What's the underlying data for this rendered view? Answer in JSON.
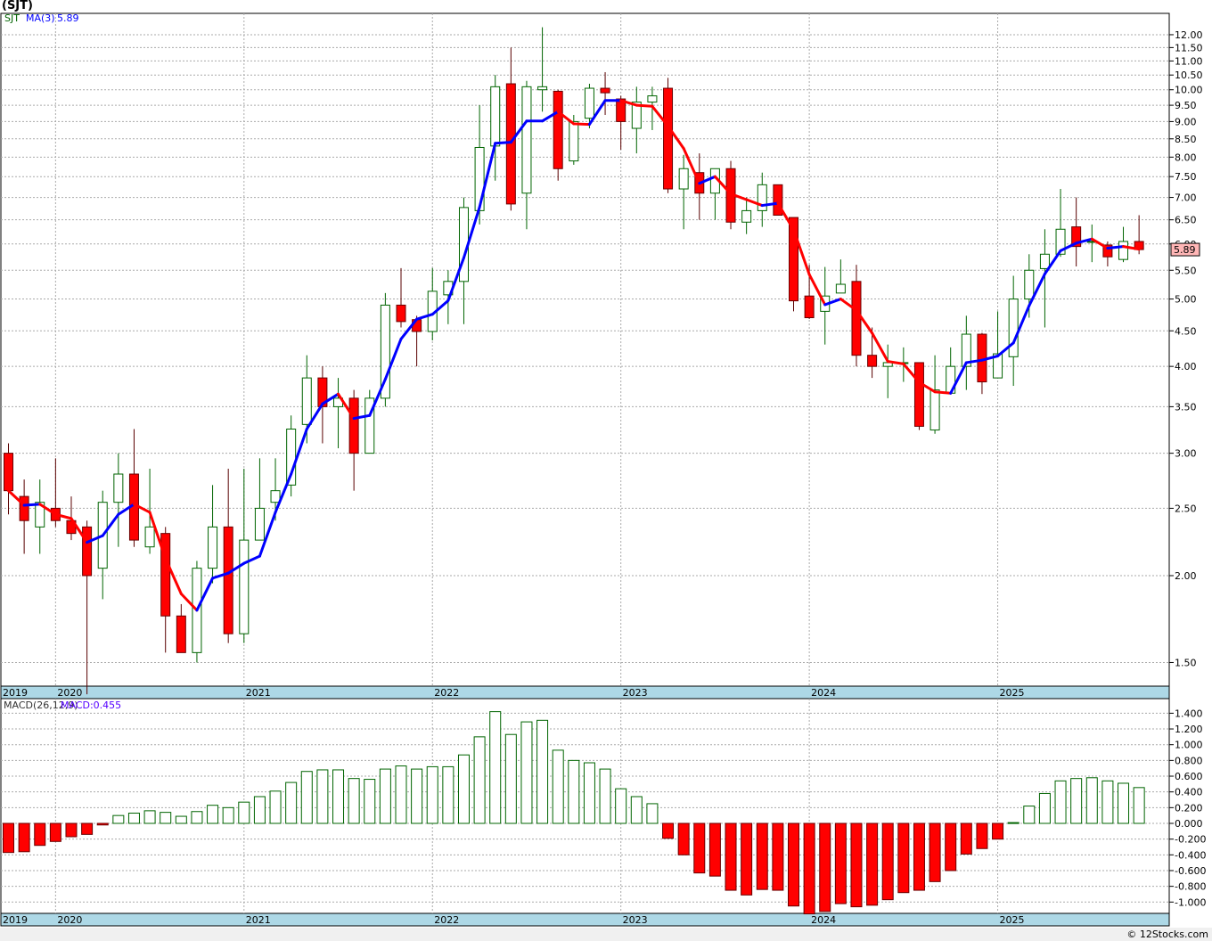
{
  "title": "(SJT)",
  "footer": "© 12Stocks.com",
  "colors": {
    "up": "#006400",
    "down": "#ff0000",
    "ma_up": "#0000ff",
    "ma_down": "#ff0000",
    "date_band": "#add8e6",
    "last_price_box": "#ffb6b6"
  },
  "chart_data": [
    {
      "type": "candlestick",
      "title": "",
      "legend": {
        "symbol": "SJT",
        "indicator": "MA(3)",
        "value": "5.89"
      },
      "y_scale": "log",
      "ylim": [
        1.35,
        12.6
      ],
      "y_ticks": [
        "12.00",
        "11.50",
        "11.00",
        "10.50",
        "10.00",
        "9.50",
        "9.00",
        "8.50",
        "8.00",
        "7.50",
        "7.00",
        "6.50",
        "6.00",
        "5.50",
        "5.00",
        "4.50",
        "4.00",
        "3.50",
        "3.00",
        "2.50",
        "2.00",
        "1.50"
      ],
      "last_price": "5.89",
      "x_labels": [
        "2019",
        "2020",
        "2021",
        "2022",
        "2023",
        "2024",
        "2025"
      ],
      "grid": true,
      "columns": [
        "month",
        "open",
        "high",
        "low",
        "close"
      ],
      "candles": [
        [
          "2019-10",
          3.0,
          3.1,
          2.45,
          2.65
        ],
        [
          "2019-11",
          2.6,
          2.75,
          2.15,
          2.4
        ],
        [
          "2019-12",
          2.35,
          2.75,
          2.15,
          2.55
        ],
        [
          "2020-01",
          2.5,
          2.95,
          2.35,
          2.4
        ],
        [
          "2020-02",
          2.4,
          2.6,
          2.25,
          2.3
        ],
        [
          "2020-03",
          2.35,
          2.4,
          1.35,
          2.0
        ],
        [
          "2020-04",
          2.05,
          2.65,
          1.85,
          2.55
        ],
        [
          "2020-05",
          2.55,
          3.0,
          2.2,
          2.8
        ],
        [
          "2020-06",
          2.8,
          3.25,
          2.2,
          2.25
        ],
        [
          "2020-07",
          2.2,
          2.85,
          2.15,
          2.35
        ],
        [
          "2020-08",
          2.3,
          2.35,
          1.55,
          1.75
        ],
        [
          "2020-09",
          1.75,
          1.82,
          1.55,
          1.55
        ],
        [
          "2020-10",
          1.55,
          2.1,
          1.5,
          2.05
        ],
        [
          "2020-11",
          2.05,
          2.7,
          1.95,
          2.35
        ],
        [
          "2020-12",
          2.35,
          2.85,
          1.6,
          1.65
        ],
        [
          "2021-01",
          1.65,
          2.85,
          1.6,
          2.25
        ],
        [
          "2021-02",
          2.25,
          2.95,
          2.3,
          2.5
        ],
        [
          "2021-03",
          2.55,
          2.95,
          2.4,
          2.65
        ],
        [
          "2021-04",
          2.7,
          3.4,
          2.6,
          3.25
        ],
        [
          "2021-05",
          3.3,
          4.15,
          3.1,
          3.85
        ],
        [
          "2021-06",
          3.85,
          4.0,
          3.1,
          3.5
        ],
        [
          "2021-07",
          3.5,
          3.85,
          3.05,
          3.6
        ],
        [
          "2021-08",
          3.6,
          3.7,
          2.65,
          3.0
        ],
        [
          "2021-09",
          3.0,
          3.7,
          3.0,
          3.6
        ],
        [
          "2021-10",
          3.6,
          5.1,
          3.5,
          4.9
        ],
        [
          "2021-11",
          4.9,
          5.54,
          4.55,
          4.64
        ],
        [
          "2021-12",
          4.67,
          4.73,
          4.0,
          4.49
        ],
        [
          "2022-01",
          4.49,
          5.54,
          4.36,
          5.13
        ],
        [
          "2022-02",
          5.07,
          5.5,
          4.6,
          5.3
        ],
        [
          "2022-03",
          5.3,
          7.0,
          4.6,
          6.77
        ],
        [
          "2022-04",
          6.7,
          9.5,
          6.4,
          8.26
        ],
        [
          "2022-05",
          8.3,
          10.5,
          7.4,
          10.1
        ],
        [
          "2022-06",
          10.2,
          11.5,
          6.7,
          6.85
        ],
        [
          "2022-07",
          7.1,
          10.3,
          6.3,
          10.1
        ],
        [
          "2022-08",
          10.0,
          12.3,
          9.3,
          10.1
        ],
        [
          "2022-09",
          9.95,
          10.0,
          7.4,
          7.7
        ],
        [
          "2022-10",
          7.9,
          9.2,
          7.8,
          9.0
        ],
        [
          "2022-11",
          9.1,
          10.2,
          8.8,
          10.05
        ],
        [
          "2022-12",
          10.05,
          10.6,
          9.2,
          9.9
        ],
        [
          "2023-01",
          9.7,
          9.8,
          8.2,
          9.0
        ],
        [
          "2023-02",
          8.8,
          10.1,
          8.1,
          9.6
        ],
        [
          "2023-03",
          9.6,
          10.1,
          8.75,
          9.8
        ],
        [
          "2023-04",
          10.05,
          10.4,
          7.1,
          7.2
        ],
        [
          "2023-05",
          7.2,
          8.06,
          6.3,
          7.7
        ],
        [
          "2023-06",
          7.6,
          8.1,
          6.5,
          7.1
        ],
        [
          "2023-07",
          7.1,
          7.7,
          6.5,
          7.7
        ],
        [
          "2023-08",
          7.7,
          7.9,
          6.3,
          6.45
        ],
        [
          "2023-09",
          6.45,
          7.0,
          6.2,
          6.7
        ],
        [
          "2023-10",
          6.7,
          7.6,
          6.35,
          7.3
        ],
        [
          "2023-11",
          7.3,
          7.3,
          6.6,
          6.6
        ],
        [
          "2023-12",
          6.55,
          6.55,
          4.8,
          4.97
        ],
        [
          "2024-01",
          5.05,
          5.6,
          4.68,
          4.7
        ],
        [
          "2024-02",
          4.8,
          5.56,
          4.3,
          5.05
        ],
        [
          "2024-03",
          5.1,
          5.7,
          5.1,
          5.25
        ],
        [
          "2024-04",
          5.3,
          5.6,
          4.0,
          4.15
        ],
        [
          "2024-05",
          4.15,
          4.55,
          3.85,
          4.0
        ],
        [
          "2024-06",
          4.0,
          4.3,
          3.6,
          4.05
        ],
        [
          "2024-07",
          4.05,
          4.26,
          3.8,
          4.05
        ],
        [
          "2024-08",
          4.05,
          4.05,
          3.24,
          3.28
        ],
        [
          "2024-09",
          3.24,
          4.15,
          3.2,
          3.7
        ],
        [
          "2024-10",
          3.66,
          4.26,
          3.66,
          4.0
        ],
        [
          "2024-11",
          4.0,
          4.73,
          3.7,
          4.45
        ],
        [
          "2024-12",
          4.45,
          4.47,
          3.65,
          3.8
        ],
        [
          "2025-01",
          3.85,
          4.8,
          3.85,
          4.17
        ],
        [
          "2025-02",
          4.13,
          5.4,
          3.75,
          5.0
        ],
        [
          "2025-03",
          5.0,
          5.8,
          4.7,
          5.5
        ],
        [
          "2025-04",
          5.53,
          6.3,
          4.55,
          5.8
        ],
        [
          "2025-05",
          5.8,
          7.2,
          5.75,
          6.3
        ],
        [
          "2025-06",
          6.35,
          7.0,
          5.57,
          5.95
        ],
        [
          "2025-07",
          6.04,
          6.4,
          5.65,
          6.05
        ],
        [
          "2025-08",
          5.98,
          6.05,
          5.57,
          5.75
        ],
        [
          "2025-09",
          5.7,
          6.35,
          5.65,
          6.05
        ],
        [
          "2025-10",
          6.05,
          6.6,
          5.8,
          5.89
        ]
      ],
      "ma_period": 3
    },
    {
      "type": "bar",
      "title": "",
      "legend": {
        "indicator": "MACD(26,12,9)",
        "value": "MACD:0.455"
      },
      "ylim": [
        -1.1,
        1.5
      ],
      "y_ticks": [
        "1.400",
        "1.200",
        "1.000",
        "0.800",
        "0.600",
        "0.400",
        "0.200",
        "0.000",
        "-0.200",
        "-0.400",
        "-0.600",
        "-0.800",
        "-1.000"
      ],
      "x_labels": [
        "2019",
        "2020",
        "2021",
        "2022",
        "2023",
        "2024",
        "2025"
      ],
      "grid": true,
      "values": [
        -0.37,
        -0.36,
        -0.28,
        -0.23,
        -0.17,
        -0.14,
        -0.02,
        0.1,
        0.13,
        0.16,
        0.14,
        0.09,
        0.15,
        0.23,
        0.2,
        0.27,
        0.34,
        0.41,
        0.52,
        0.66,
        0.68,
        0.68,
        0.57,
        0.56,
        0.69,
        0.73,
        0.69,
        0.72,
        0.72,
        0.87,
        1.1,
        1.42,
        1.13,
        1.29,
        1.31,
        0.93,
        0.8,
        0.77,
        0.69,
        0.44,
        0.34,
        0.25,
        -0.19,
        -0.4,
        -0.63,
        -0.67,
        -0.85,
        -0.91,
        -0.84,
        -0.85,
        -1.05,
        -1.15,
        -1.12,
        -1.02,
        -1.06,
        -1.04,
        -0.97,
        -0.88,
        -0.85,
        -0.74,
        -0.6,
        -0.39,
        -0.32,
        -0.2,
        0.01,
        0.22,
        0.38,
        0.54,
        0.57,
        0.58,
        0.54,
        0.51,
        0.455
      ]
    }
  ]
}
